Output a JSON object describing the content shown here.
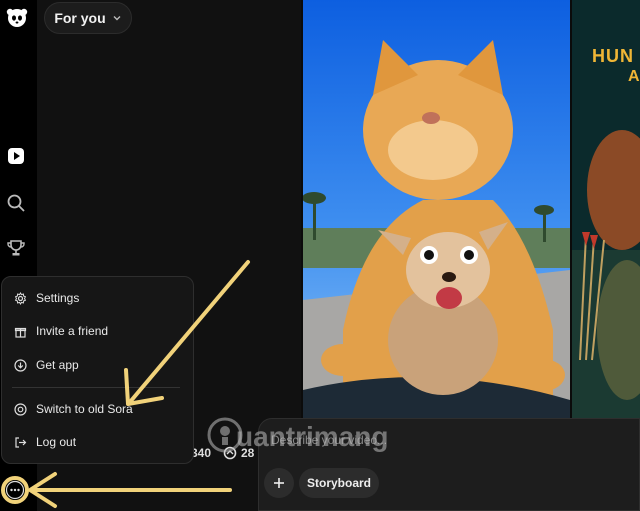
{
  "header": {
    "feed_label": "For you"
  },
  "menu": {
    "items": [
      {
        "label": "Settings",
        "icon": "gear-icon"
      },
      {
        "label": "Invite a friend",
        "icon": "gift-icon"
      },
      {
        "label": "Get app",
        "icon": "download-icon"
      },
      {
        "label": "Switch to old Sora",
        "icon": "sora-icon"
      },
      {
        "label": "Log out",
        "icon": "logout-icon"
      }
    ]
  },
  "stats": {
    "likes": "340",
    "remixes": "28"
  },
  "composer": {
    "placeholder": "Describe your video...",
    "storyboard_label": "Storyboard"
  },
  "video_right": {
    "title": "HUN",
    "subtitle": "A"
  },
  "watermark": {
    "text": "uantrimang"
  },
  "colors": {
    "annotation_arrow": "#f1d27a",
    "accent_gold": "#f0b636"
  }
}
